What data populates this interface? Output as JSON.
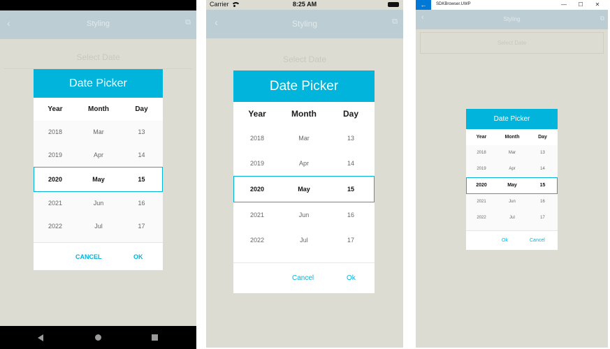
{
  "colors": {
    "accent": "#00b4dc",
    "navbar": "#bccdd3",
    "page_background": "#dddcd3",
    "uwp_blue": "#0078d7"
  },
  "screens": [
    {
      "platform": "Android",
      "navbar": {
        "back_icon": "chevron-left-icon",
        "title": "Styling",
        "action_icon": "external-link-icon"
      },
      "select_date": "Select Date",
      "dialog": {
        "title": "Date Picker",
        "columns": [
          "Year",
          "Month",
          "Day"
        ],
        "rows": [
          [
            "2018",
            "Mar",
            "13"
          ],
          [
            "2019",
            "Apr",
            "14"
          ],
          [
            "2020",
            "May",
            "15"
          ],
          [
            "2021",
            "Jun",
            "16"
          ],
          [
            "2022",
            "Jul",
            "17"
          ]
        ],
        "selected_index": 2,
        "cancel_label": "CANCEL",
        "ok_label": "OK"
      },
      "system_nav": {
        "back": "back-triangle-icon",
        "home": "home-circle-icon",
        "recents": "recents-square-icon"
      }
    },
    {
      "platform": "iOS",
      "status_bar": {
        "carrier": "Carrier",
        "time": "8:25 AM"
      },
      "navbar": {
        "back_icon": "chevron-left-icon",
        "title": "Styling",
        "action_icon": "external-link-icon"
      },
      "select_date": "Select Date",
      "dialog": {
        "title": "Date Picker",
        "columns": [
          "Year",
          "Month",
          "Day"
        ],
        "rows": [
          [
            "2018",
            "Mar",
            "13"
          ],
          [
            "2019",
            "Apr",
            "14"
          ],
          [
            "2020",
            "May",
            "15"
          ],
          [
            "2021",
            "Jun",
            "16"
          ],
          [
            "2022",
            "Jul",
            "17"
          ]
        ],
        "selected_index": 2,
        "cancel_label": "Cancel",
        "ok_label": "Ok"
      }
    },
    {
      "platform": "UWP",
      "title_bar": {
        "app_name": "SDKBrowser.UWP",
        "minimize": "—",
        "maximize": "☐",
        "close": "✕",
        "back": "←"
      },
      "navbar": {
        "back_icon": "chevron-left-icon",
        "title": "Styling",
        "action_icon": "external-link-icon"
      },
      "select_date": "Select Date",
      "dialog": {
        "title": "Date Picker",
        "columns": [
          "Year",
          "Month",
          "Day"
        ],
        "rows": [
          [
            "2018",
            "Mar",
            "13"
          ],
          [
            "2019",
            "Apr",
            "14"
          ],
          [
            "2020",
            "May",
            "15"
          ],
          [
            "2021",
            "Jun",
            "16"
          ],
          [
            "2022",
            "Jul",
            "17"
          ]
        ],
        "selected_index": 2,
        "ok_label": "Ok",
        "cancel_label": "Cancel"
      }
    }
  ]
}
